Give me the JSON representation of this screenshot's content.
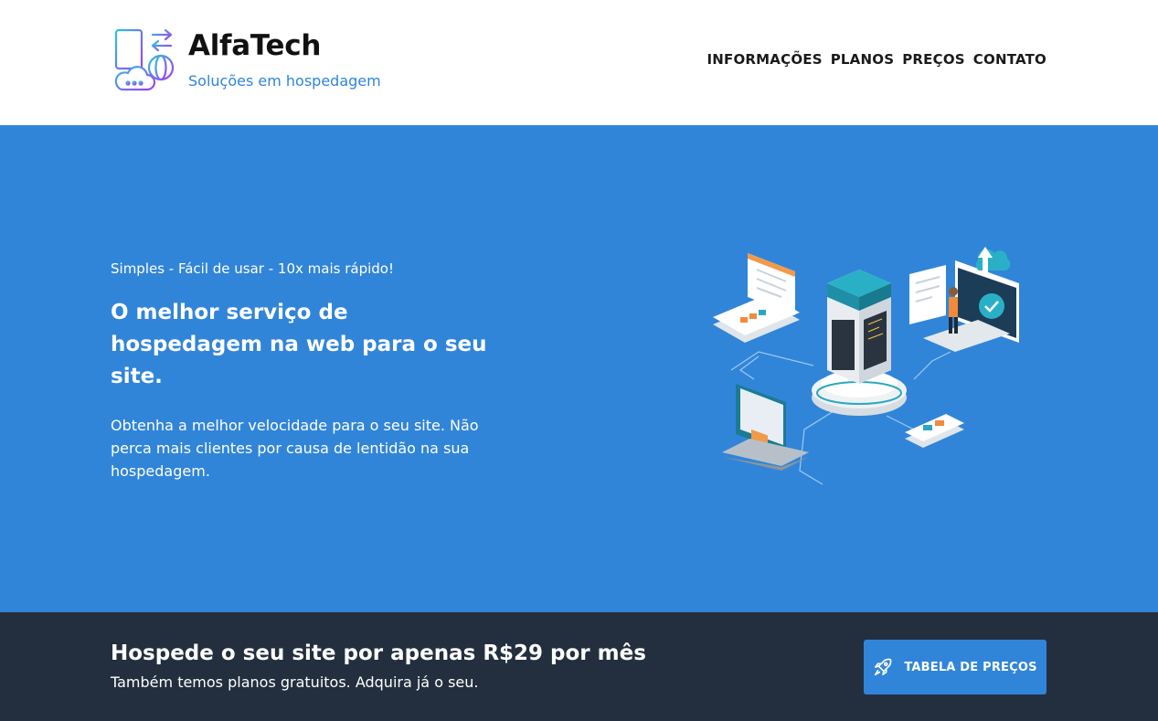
{
  "brand": {
    "name": "AlfaTech",
    "tagline": "Soluções em hospedagem",
    "logo_icon": "server-cloud-globe-icon"
  },
  "nav": {
    "items": [
      {
        "label": "INFORMAÇÕES"
      },
      {
        "label": "PLANOS"
      },
      {
        "label": "PREÇOS"
      },
      {
        "label": "CONTATO"
      }
    ]
  },
  "hero": {
    "eyebrow": "Simples - Fácil de usar - 10x mais rápido!",
    "title": "O melhor serviço de hospedagem na web para o seu site.",
    "description": "Obtenha a melhor velocidade para o seu site. Não perca mais clientes por causa de lentidão na sua hospedagem.",
    "illustration": "isometric-server-hosting-illustration",
    "background_color": "#3185d8"
  },
  "cta": {
    "title": "Hospede o seu site por apenas R$29 por mês",
    "subtitle": "Também temos planos gratuitos. Adquira já o seu.",
    "button_label": "TABELA DE PREÇOS",
    "button_icon": "rocket-icon",
    "background_color": "#232f3e",
    "accent_color": "#3185d8"
  }
}
